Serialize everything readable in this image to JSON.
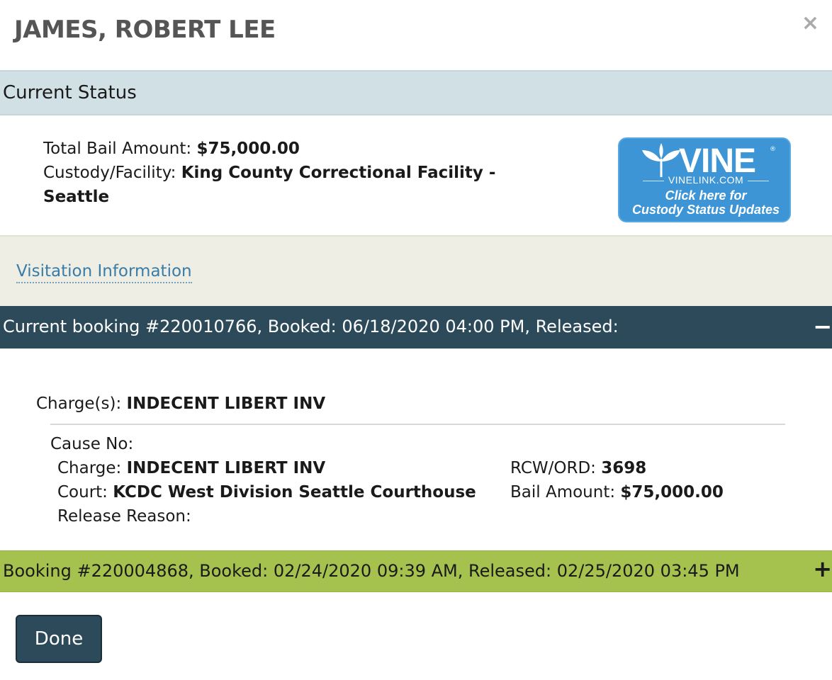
{
  "header": {
    "title": "JAMES, ROBERT LEE",
    "close_symbol": "×"
  },
  "current_status": {
    "heading": "Current Status",
    "bail_label": "Total Bail Amount:",
    "bail_value": "$75,000.00",
    "facility_label": "Custody/Facility:",
    "facility_value_line1": "King County Correctional Facility -",
    "facility_value_line2": "Seattle"
  },
  "vine": {
    "logo_text": "VINE",
    "registered": "®",
    "site": "VINELINK.COM",
    "cta_line1": "Click here for",
    "cta_line2": "Custody Status Updates",
    "color": "#3d95d6"
  },
  "visitation": {
    "link_text": "Visitation Information"
  },
  "current_booking": {
    "header_text": "Current booking #220010766, Booked: 06/18/2020 04:00 PM, Released:",
    "toggle": "−",
    "charges_label": "Charge(s):",
    "charges_value": "INDECENT LIBERT INV",
    "cause_label": "Cause No:",
    "charge_label": "Charge:",
    "charge_value": "INDECENT LIBERT INV",
    "court_label": "Court:",
    "court_value": "KCDC West Division Seattle Courthouse",
    "release_label": "Release Reason:",
    "rcw_label": "RCW/ORD:",
    "rcw_value": "3698",
    "bail_label": "Bail Amount:",
    "bail_value": "$75,000.00",
    "color": "#2c4a5a"
  },
  "past_booking": {
    "header_text": "Booking #220004868, Booked: 02/24/2020 09:39 AM, Released: 02/25/2020 03:45 PM",
    "toggle": "+",
    "color": "#a6c24e"
  },
  "footer": {
    "done_label": "Done"
  }
}
